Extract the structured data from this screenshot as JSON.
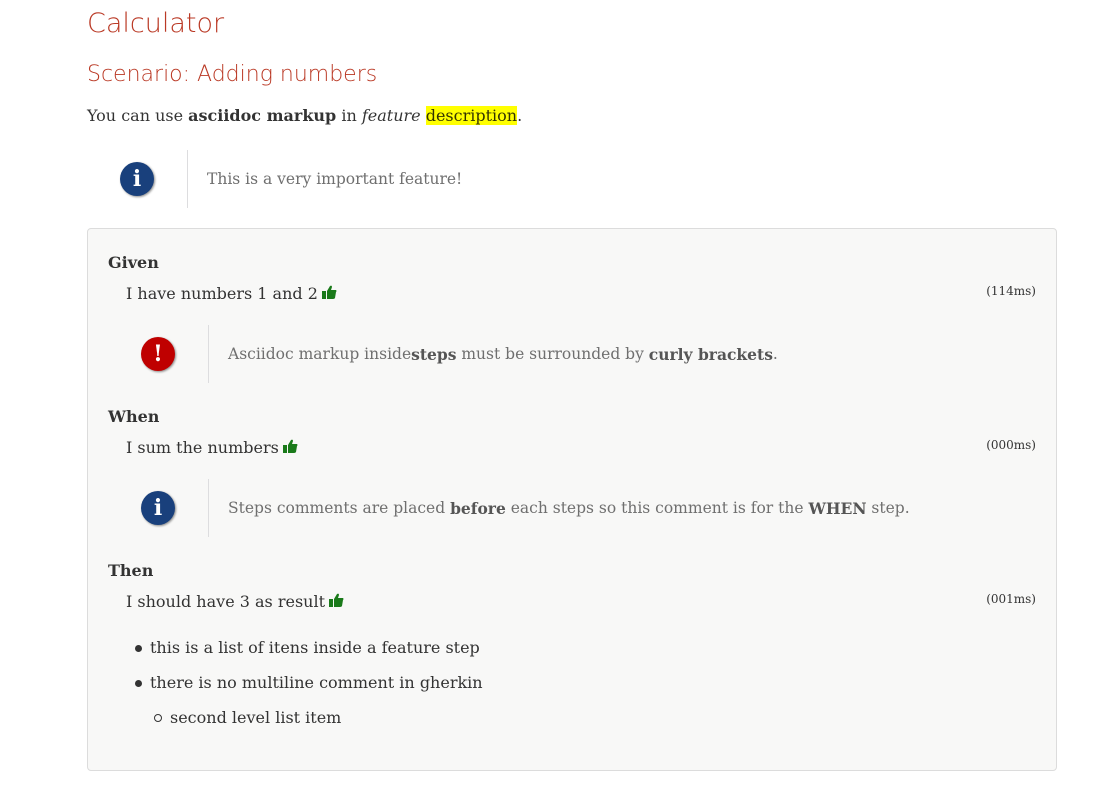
{
  "feature": {
    "title": "Calculator"
  },
  "scenario": {
    "title": "Scenario: Adding numbers",
    "description": {
      "t1": "You can use ",
      "b1": "asciidoc markup",
      "t2": " in ",
      "i1": "feature",
      "t3": " ",
      "mark": "description",
      "t4": "."
    }
  },
  "note": {
    "icon": "info-icon",
    "text": "This is a very important feature!"
  },
  "steps": {
    "given": {
      "keyword": "Given",
      "text": "I have numbers 1 and 2",
      "duration": "(114ms)",
      "comment": {
        "icon": "warning-icon",
        "t1": "Asciidoc markup inside ",
        "b1": "steps",
        "t2": " must be surrounded by ",
        "b2": "curly brackets",
        "t3": "."
      }
    },
    "when": {
      "keyword": "When",
      "text": "I sum the numbers",
      "duration": "(000ms)",
      "comment": {
        "icon": "info-icon",
        "t1": "Steps comments are placed ",
        "b1": "before",
        "t2": " each steps so this comment is for the ",
        "b2": "WHEN",
        "t3": " step."
      }
    },
    "then": {
      "keyword": "Then",
      "text": "I should have 3 as result",
      "duration": "(001ms)",
      "list": [
        "this is a list of itens inside a feature step",
        "there is no multiline comment in gherkin",
        "second level list item"
      ]
    }
  },
  "colors": {
    "heading": "#ba3925",
    "highlight": "#ffff00",
    "pass": "#1a7a1a",
    "info": "#19407c",
    "warning": "#bf0000"
  }
}
